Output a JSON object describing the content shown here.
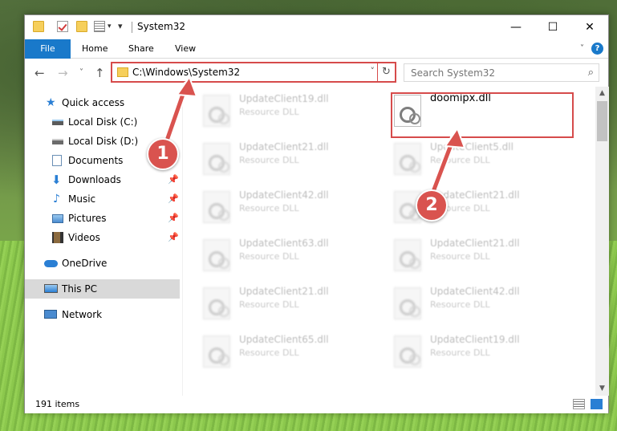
{
  "window": {
    "title": "System32",
    "help_glyph": "?"
  },
  "title_buttons": {
    "minimize": "—",
    "maximize": "☐",
    "close": "✕"
  },
  "ribbon": {
    "tabs": [
      "File",
      "Home",
      "Share",
      "View"
    ],
    "expand_glyph": "˅"
  },
  "navigation": {
    "back": "←",
    "forward": "→",
    "recent": "˅",
    "up": "↑",
    "address": "C:\\Windows\\System32",
    "address_dropdown": "˅",
    "refresh": "↻",
    "search_placeholder": "Search System32",
    "search_glyph": "⌕"
  },
  "sidebar": {
    "items": [
      {
        "label": "Quick access",
        "icon": "star-icon"
      },
      {
        "label": "Local Disk (C:)",
        "icon": "drive-icon"
      },
      {
        "label": "Local Disk (D:)",
        "icon": "drive-icon"
      },
      {
        "label": "Documents",
        "icon": "documents-icon",
        "pin": "📌"
      },
      {
        "label": "Downloads",
        "icon": "download-icon",
        "pin": "📌"
      },
      {
        "label": "Music",
        "icon": "music-icon",
        "pin": "📌"
      },
      {
        "label": "Pictures",
        "icon": "pictures-icon",
        "pin": "📌"
      },
      {
        "label": "Videos",
        "icon": "videos-icon",
        "pin": "📌"
      },
      {
        "label": "OneDrive",
        "icon": "cloud-icon"
      },
      {
        "label": "This PC",
        "icon": "computer-icon",
        "selected": true
      },
      {
        "label": "Network",
        "icon": "network-icon"
      }
    ]
  },
  "files": {
    "col1": [
      {
        "name": "UpdateClient19.dll",
        "type": "Resource DLL"
      },
      {
        "name": "UpdateClient21.dll",
        "type": "Resource DLL"
      },
      {
        "name": "UpdateClient42.dll",
        "type": "Resource DLL"
      },
      {
        "name": "UpdateClient63.dll",
        "type": "Resource DLL"
      },
      {
        "name": "UpdateClient21.dll",
        "type": "Resource DLL"
      },
      {
        "name": "UpdateClient65.dll",
        "type": "Resource DLL"
      }
    ],
    "col2": [
      {
        "name": "doomipx.dll",
        "type": ""
      },
      {
        "name": "UpdateClient5.dll",
        "type": "Resource DLL"
      },
      {
        "name": "UpdateClient21.dll",
        "type": "Resource DLL"
      },
      {
        "name": "UpdateClient21.dll",
        "type": "Resource DLL"
      },
      {
        "name": "UpdateClient42.dll",
        "type": "Resource DLL"
      },
      {
        "name": "UpdateClient19.dll",
        "type": "Resource DLL"
      }
    ]
  },
  "scrollbar": {
    "up": "▲",
    "down": "▼"
  },
  "status": {
    "item_count": "191 items"
  },
  "annotations": {
    "step1": "1",
    "step2": "2"
  },
  "colors": {
    "accent": "#1979ca",
    "highlight": "#d64b4b",
    "callout": "#d9534f"
  }
}
